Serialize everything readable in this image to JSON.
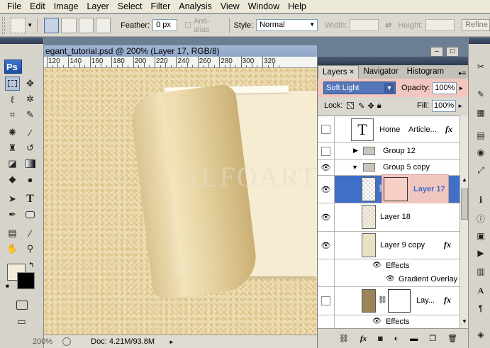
{
  "menu": [
    "File",
    "Edit",
    "Image",
    "Layer",
    "Select",
    "Filter",
    "Analysis",
    "View",
    "Window",
    "Help"
  ],
  "options": {
    "feather_label": "Feather:",
    "feather_value": "0 px",
    "antialias_label": "Anti-alias",
    "style_label": "Style:",
    "style_value": "Normal",
    "width_label": "Width:",
    "height_label": "Height:",
    "refine_label": "Refine"
  },
  "tools": {
    "app_badge": "Ps"
  },
  "document": {
    "title": "egant_tutorial.psd @ 200% (Layer 17, RGB/8)",
    "ruler_labels": [
      "120",
      "140",
      "160",
      "180",
      "200",
      "220",
      "240",
      "260",
      "280",
      "300",
      "320"
    ],
    "watermark": "ALFOART",
    "status_zoom": "200%",
    "status_doc": "Doc: 4.21M/93.8M"
  },
  "layers_panel": {
    "tabs": [
      "Layers",
      "Navigator",
      "Histogram"
    ],
    "tab_close": "×",
    "blend_mode": "Soft Light",
    "opacity_label": "Opacity:",
    "opacity_value": "100%",
    "lock_label": "Lock:",
    "fill_label": "Fill:",
    "fill_value": "100%",
    "rows": [
      {
        "name": "Home",
        "extra": "Article...",
        "thumb": "T"
      },
      {
        "name": "Group 12"
      },
      {
        "name": "Group 5 copy"
      },
      {
        "name": "Layer 17"
      },
      {
        "name": "Layer 18"
      },
      {
        "name": "Layer 9 copy"
      },
      {
        "name": "Effects"
      },
      {
        "name": "Gradient Overlay"
      },
      {
        "name": "Lay..."
      },
      {
        "name": "Effects"
      }
    ],
    "fx_label": "fx",
    "footer_icons": [
      "link-icon",
      "fx-icon",
      "mask-icon",
      "adjustment-icon",
      "group-icon",
      "new-layer-icon",
      "trash-icon"
    ]
  },
  "colors": {
    "selection_blue": "#3f6fc6",
    "highlight_pink": "#f2c7bf",
    "paper": "#efe0b8"
  }
}
